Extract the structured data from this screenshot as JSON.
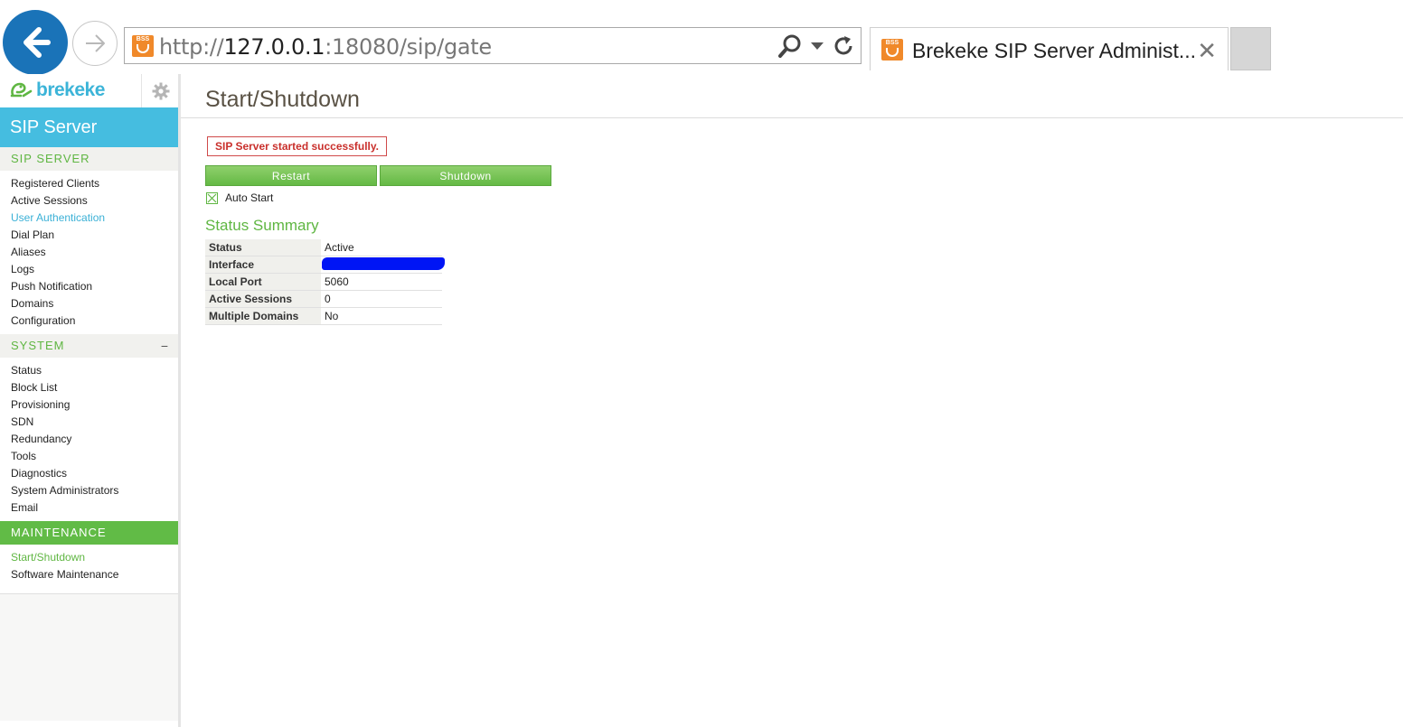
{
  "browser": {
    "url_prefix": "http://",
    "url_host": "127.0.0.1",
    "url_rest": ":18080/sip/gate",
    "tab_title": "Brekeke SIP Server Administ...",
    "favicon_label": "BSS"
  },
  "sidebar": {
    "logo_text": "brekeke",
    "product": "SIP Server",
    "sections": [
      {
        "title": "SIP SERVER",
        "collapse": "",
        "items": [
          "Registered Clients",
          "Active Sessions",
          "User Authentication",
          "Dial Plan",
          "Aliases",
          "Logs",
          "Push Notification",
          "Domains",
          "Configuration"
        ]
      },
      {
        "title": "SYSTEM",
        "collapse": "−",
        "items": [
          "Status",
          "Block List",
          "Provisioning",
          "SDN",
          "Redundancy",
          "Tools",
          "Diagnostics",
          "System Administrators",
          "Email"
        ]
      },
      {
        "title": "MAINTENANCE",
        "collapse": "",
        "items": [
          "Start/Shutdown",
          "Software Maintenance"
        ]
      }
    ]
  },
  "main": {
    "title": "Start/Shutdown",
    "message": "SIP Server started successfully.",
    "restart_label": "Restart",
    "shutdown_label": "Shutdown",
    "auto_start_label": "Auto Start",
    "auto_start_checked": true,
    "summary_title": "Status Summary",
    "summary": {
      "status_label": "Status",
      "status_value": "Active",
      "interface_label": "Interface",
      "interface_value": "",
      "port_label": "Local Port",
      "port_value": "5060",
      "sessions_label": "Active Sessions",
      "sessions_value": "0",
      "domains_label": "Multiple Domains",
      "domains_value": "No"
    }
  },
  "colors": {
    "accent_blue": "#45bde0",
    "accent_green": "#61bb46",
    "error_red": "#c9302c"
  }
}
